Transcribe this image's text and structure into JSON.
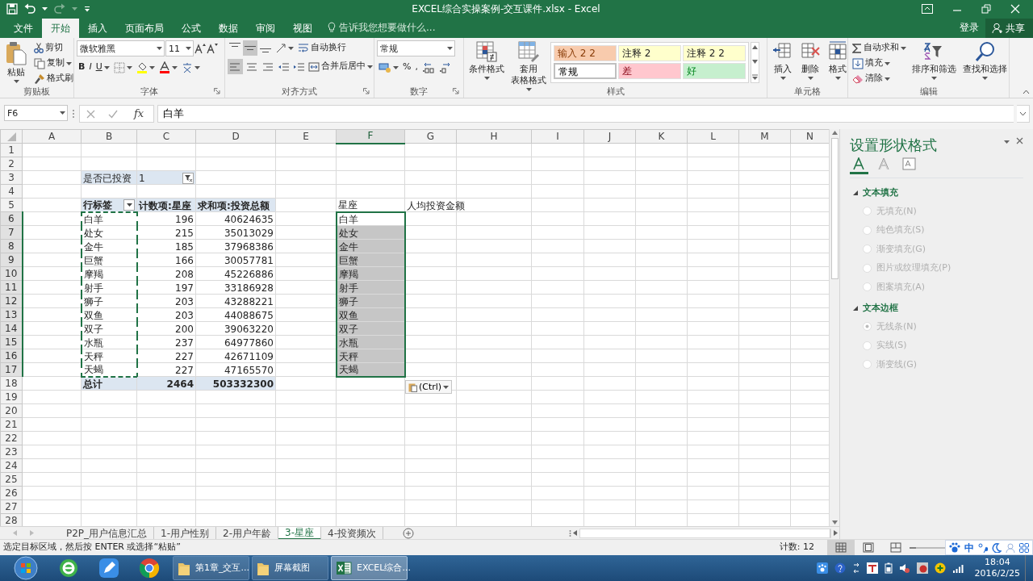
{
  "window": {
    "title": "EXCEL综合实操案例-交互课件.xlsx - Excel"
  },
  "ribbon_tabs": [
    {
      "label": "文件",
      "selected": false
    },
    {
      "label": "开始",
      "selected": true
    },
    {
      "label": "插入",
      "selected": false
    },
    {
      "label": "页面布局",
      "selected": false
    },
    {
      "label": "公式",
      "selected": false
    },
    {
      "label": "数据",
      "selected": false
    },
    {
      "label": "审阅",
      "selected": false
    },
    {
      "label": "视图",
      "selected": false
    }
  ],
  "tell_me": {
    "placeholder": "告诉我您想要做什么..."
  },
  "account": {
    "sign_in": "登录",
    "share": "共享"
  },
  "clipboard": {
    "paste": "粘贴",
    "cut": "剪切",
    "copy": "复制",
    "format_painter": "格式刷",
    "label": "剪贴板"
  },
  "font": {
    "font_name": "微软雅黑",
    "font_size": "11",
    "bold": "B",
    "italic": "I",
    "underline": "U",
    "label": "字体"
  },
  "alignment": {
    "vertical": [
      {
        "selected": false
      },
      {
        "selected": true
      },
      {
        "selected": false
      }
    ],
    "horizontal": [
      {
        "selected": true
      },
      {
        "selected": false
      },
      {
        "selected": false
      }
    ],
    "wrap_text": "自动换行",
    "merge_center": "合并后居中",
    "label": "对齐方式"
  },
  "number": {
    "format": "常规",
    "percent": "%",
    "comma": ",",
    "label": "数字"
  },
  "styles": {
    "conditional_formatting": "条件格式",
    "format_as_table": [
      "套用",
      "表格格式"
    ],
    "cell_styles": [
      {
        "label": "输入 2 2",
        "color": "#f8cbad"
      },
      {
        "label": "注释 2",
        "color": "#ffffcc"
      },
      {
        "label": "注释 2 2",
        "color": "#ffffcc"
      },
      {
        "label": "常规",
        "color": "#ffffff"
      },
      {
        "label": "差",
        "color": "#ffc7ce"
      },
      {
        "label": "好",
        "color": "#c6efce"
      }
    ],
    "label": "样式"
  },
  "cells": {
    "insert": "插入",
    "delete": "删除",
    "format": "格式",
    "label": "单元格"
  },
  "editing": {
    "autosum": "自动求和",
    "fill": "填充",
    "clear": "清除",
    "sort_filter": "排序和筛选",
    "find_select": "查找和选择",
    "label": "编辑"
  },
  "formula_bar": {
    "name_box": "F6",
    "function_label": "fx",
    "formula": "白羊"
  },
  "sheet": {
    "columns": [
      {
        "label": "A",
        "selected": false
      },
      {
        "label": "B",
        "selected": false
      },
      {
        "label": "C",
        "selected": false
      },
      {
        "label": "D",
        "selected": false
      },
      {
        "label": "E",
        "selected": false
      },
      {
        "label": "F",
        "selected": true
      },
      {
        "label": "G",
        "selected": false
      },
      {
        "label": "H",
        "selected": false
      },
      {
        "label": "I",
        "selected": false
      },
      {
        "label": "J",
        "selected": false
      },
      {
        "label": "K",
        "selected": false
      },
      {
        "label": "L",
        "selected": false
      },
      {
        "label": "M",
        "selected": false
      },
      {
        "label": "N",
        "selected": false
      }
    ],
    "rows": [
      {
        "label": "1",
        "selected": false
      },
      {
        "label": "2",
        "selected": false
      },
      {
        "label": "3",
        "selected": false,
        "cells": {
          "B": {
            "text": "是否已投资",
            "kind": "filter_label"
          },
          "C": {
            "text": "1",
            "kind": "filter_value"
          }
        }
      },
      {
        "label": "4",
        "selected": false
      },
      {
        "label": "5",
        "selected": false,
        "cells": {
          "B": {
            "text": "行标签",
            "kind": "header_dropdown"
          },
          "C": {
            "text": "计数项:星座",
            "kind": "header"
          },
          "D": {
            "text": "求和项:投资总额",
            "kind": "header"
          },
          "F": {
            "text": "星座",
            "kind": "label"
          },
          "G": {
            "text": "人均投资金额",
            "kind": "label"
          }
        }
      },
      {
        "label": "6",
        "selected": true,
        "cells": {
          "B": {
            "text": "白羊",
            "kind": "label",
            "copied": true
          },
          "C": {
            "text": "196",
            "kind": "number"
          },
          "D": {
            "text": "40624635",
            "kind": "number"
          },
          "F": {
            "text": "白羊",
            "kind": "label",
            "selected": true,
            "active": true
          }
        }
      },
      {
        "label": "7",
        "selected": true,
        "cells": {
          "B": {
            "text": "处女",
            "kind": "label",
            "copied": true
          },
          "C": {
            "text": "215",
            "kind": "number"
          },
          "D": {
            "text": "35013029",
            "kind": "number"
          },
          "F": {
            "text": "处女",
            "kind": "label",
            "selected": true,
            "active": false
          }
        }
      },
      {
        "label": "8",
        "selected": true,
        "cells": {
          "B": {
            "text": "金牛",
            "kind": "label",
            "copied": true
          },
          "C": {
            "text": "185",
            "kind": "number"
          },
          "D": {
            "text": "37968386",
            "kind": "number"
          },
          "F": {
            "text": "金牛",
            "kind": "label",
            "selected": true,
            "active": false
          }
        }
      },
      {
        "label": "9",
        "selected": true,
        "cells": {
          "B": {
            "text": "巨蟹",
            "kind": "label",
            "copied": true
          },
          "C": {
            "text": "166",
            "kind": "number"
          },
          "D": {
            "text": "30057781",
            "kind": "number"
          },
          "F": {
            "text": "巨蟹",
            "kind": "label",
            "selected": true,
            "active": false
          }
        }
      },
      {
        "label": "10",
        "selected": true,
        "cells": {
          "B": {
            "text": "摩羯",
            "kind": "label",
            "copied": true
          },
          "C": {
            "text": "208",
            "kind": "number"
          },
          "D": {
            "text": "45226886",
            "kind": "number"
          },
          "F": {
            "text": "摩羯",
            "kind": "label",
            "selected": true,
            "active": false
          }
        }
      },
      {
        "label": "11",
        "selected": true,
        "cells": {
          "B": {
            "text": "射手",
            "kind": "label",
            "copied": true
          },
          "C": {
            "text": "197",
            "kind": "number"
          },
          "D": {
            "text": "33186928",
            "kind": "number"
          },
          "F": {
            "text": "射手",
            "kind": "label",
            "selected": true,
            "active": false
          }
        }
      },
      {
        "label": "12",
        "selected": true,
        "cells": {
          "B": {
            "text": "狮子",
            "kind": "label",
            "copied": true
          },
          "C": {
            "text": "203",
            "kind": "number"
          },
          "D": {
            "text": "43288221",
            "kind": "number"
          },
          "F": {
            "text": "狮子",
            "kind": "label",
            "selected": true,
            "active": false
          }
        }
      },
      {
        "label": "13",
        "selected": true,
        "cells": {
          "B": {
            "text": "双鱼",
            "kind": "label",
            "copied": true
          },
          "C": {
            "text": "203",
            "kind": "number"
          },
          "D": {
            "text": "44088675",
            "kind": "number"
          },
          "F": {
            "text": "双鱼",
            "kind": "label",
            "selected": true,
            "active": false
          }
        }
      },
      {
        "label": "14",
        "selected": true,
        "cells": {
          "B": {
            "text": "双子",
            "kind": "label",
            "copied": true
          },
          "C": {
            "text": "200",
            "kind": "number"
          },
          "D": {
            "text": "39063220",
            "kind": "number"
          },
          "F": {
            "text": "双子",
            "kind": "label",
            "selected": true,
            "active": false
          }
        }
      },
      {
        "label": "15",
        "selected": true,
        "cells": {
          "B": {
            "text": "水瓶",
            "kind": "label",
            "copied": true
          },
          "C": {
            "text": "237",
            "kind": "number"
          },
          "D": {
            "text": "64977860",
            "kind": "number"
          },
          "F": {
            "text": "水瓶",
            "kind": "label",
            "selected": true,
            "active": false
          }
        }
      },
      {
        "label": "16",
        "selected": true,
        "cells": {
          "B": {
            "text": "天秤",
            "kind": "label",
            "copied": true
          },
          "C": {
            "text": "227",
            "kind": "number"
          },
          "D": {
            "text": "42671109",
            "kind": "number"
          },
          "F": {
            "text": "天秤",
            "kind": "label",
            "selected": true,
            "active": false
          }
        }
      },
      {
        "label": "17",
        "selected": true,
        "cells": {
          "B": {
            "text": "天蝎",
            "kind": "label",
            "copied": true
          },
          "C": {
            "text": "227",
            "kind": "number"
          },
          "D": {
            "text": "47165570",
            "kind": "number"
          },
          "F": {
            "text": "天蝎",
            "kind": "label",
            "selected": true,
            "active": false
          }
        }
      },
      {
        "label": "18",
        "selected": false,
        "cells": {
          "B": {
            "text": "总计",
            "kind": "total_label"
          },
          "C": {
            "text": "2464",
            "kind": "total_number"
          },
          "D": {
            "text": "503332300",
            "kind": "total_number"
          },
          "G": {
            "text": "(Ctrl)",
            "kind": "paste_options"
          }
        }
      },
      {
        "label": "19",
        "selected": false
      },
      {
        "label": "20",
        "selected": false
      },
      {
        "label": "21",
        "selected": false
      },
      {
        "label": "22",
        "selected": false
      },
      {
        "label": "23",
        "selected": false
      },
      {
        "label": "24",
        "selected": false
      },
      {
        "label": "25",
        "selected": false
      },
      {
        "label": "26",
        "selected": false
      },
      {
        "label": "27",
        "selected": false
      },
      {
        "label": "28",
        "selected": false
      }
    ]
  },
  "format_pane": {
    "title": "设置形状格式",
    "tabs": [
      {
        "selected": true
      },
      {
        "selected": false
      },
      {
        "selected": false
      }
    ],
    "sections": [
      {
        "title": "文本填充",
        "expanded": true,
        "options": [
          {
            "label": "无填充(N)",
            "selected": false,
            "disabled": true
          },
          {
            "label": "纯色填充(S)",
            "selected": false,
            "disabled": true
          },
          {
            "label": "渐变填充(G)",
            "selected": false,
            "disabled": true
          },
          {
            "label": "图片或纹理填充(P)",
            "selected": false,
            "disabled": true
          },
          {
            "label": "图案填充(A)",
            "selected": false,
            "disabled": true
          }
        ]
      },
      {
        "title": "文本边框",
        "expanded": true,
        "options": [
          {
            "label": "无线条(N)",
            "selected": true,
            "disabled": true
          },
          {
            "label": "实线(S)",
            "selected": false,
            "disabled": true
          },
          {
            "label": "渐变线(G)",
            "selected": false,
            "disabled": true
          }
        ]
      }
    ]
  },
  "sheet_tabs": [
    {
      "label": "P2P_用户信息汇总",
      "selected": false
    },
    {
      "label": "1-用户性别",
      "selected": false
    },
    {
      "label": "2-用户年龄",
      "selected": false
    },
    {
      "label": "3-星座",
      "selected": true
    },
    {
      "label": "4-投资频次",
      "selected": false
    }
  ],
  "status_bar": {
    "message": "选定目标区域，然后按 ENTER 或选择“粘贴”",
    "count": "计数: 12",
    "views": [
      {
        "selected": true
      },
      {
        "selected": false
      },
      {
        "selected": false
      }
    ]
  },
  "ime": {
    "mode": "中"
  },
  "taskbar": {
    "windows": [
      {
        "label": "第1章_交互...",
        "kind": "folder",
        "selected": false
      },
      {
        "label": "屏幕截图",
        "kind": "folder",
        "selected": false
      },
      {
        "label": "EXCEL综合...",
        "kind": "excel",
        "selected": true
      }
    ],
    "time": "18:04",
    "date": "2016/2/25"
  }
}
